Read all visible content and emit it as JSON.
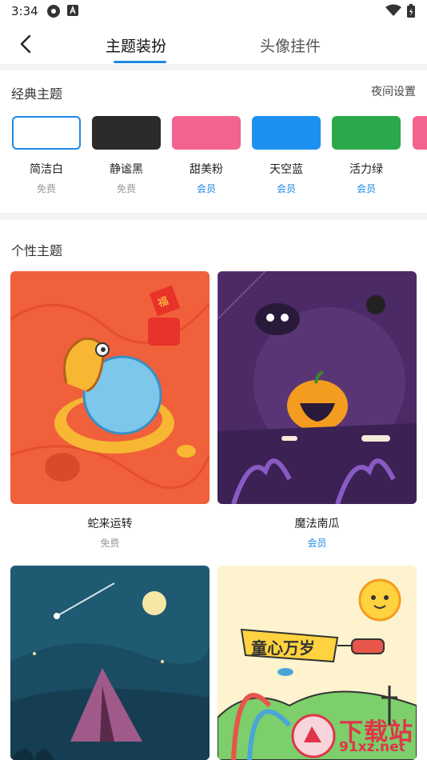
{
  "status": {
    "time": "3:34"
  },
  "tabs": [
    {
      "label": "主题装扮",
      "active": true
    },
    {
      "label": "头像挂件",
      "active": false
    }
  ],
  "classic": {
    "title": "经典主题",
    "night_setting": "夜间设置",
    "themes": [
      {
        "name": "简洁白",
        "tag": "免费",
        "tag_type": "free",
        "color": "#ffffff",
        "selected": true
      },
      {
        "name": "静谧黑",
        "tag": "免费",
        "tag_type": "free",
        "color": "#2b2b2b",
        "selected": false
      },
      {
        "name": "甜美粉",
        "tag": "会员",
        "tag_type": "vip",
        "color": "#f2648f",
        "selected": false
      },
      {
        "name": "天空蓝",
        "tag": "会员",
        "tag_type": "vip",
        "color": "#1e90f0",
        "selected": false
      },
      {
        "name": "活力绿",
        "tag": "会员",
        "tag_type": "vip",
        "color": "#2aa84a",
        "selected": false
      }
    ]
  },
  "personal": {
    "title": "个性主题",
    "themes": [
      {
        "name": "蛇来运转",
        "tag": "免费",
        "tag_type": "free"
      },
      {
        "name": "魔法南瓜",
        "tag": "会员",
        "tag_type": "vip"
      },
      {
        "name": "",
        "tag": "",
        "tag_type": ""
      },
      {
        "name": "",
        "tag": "",
        "tag_type": ""
      }
    ],
    "banner_text": "童心万岁",
    "fu_char": "福"
  },
  "colors": {
    "accent": "#1e88e5",
    "free": "#999999"
  },
  "watermark": {
    "main": "下载站",
    "sub": "91xz.net"
  }
}
